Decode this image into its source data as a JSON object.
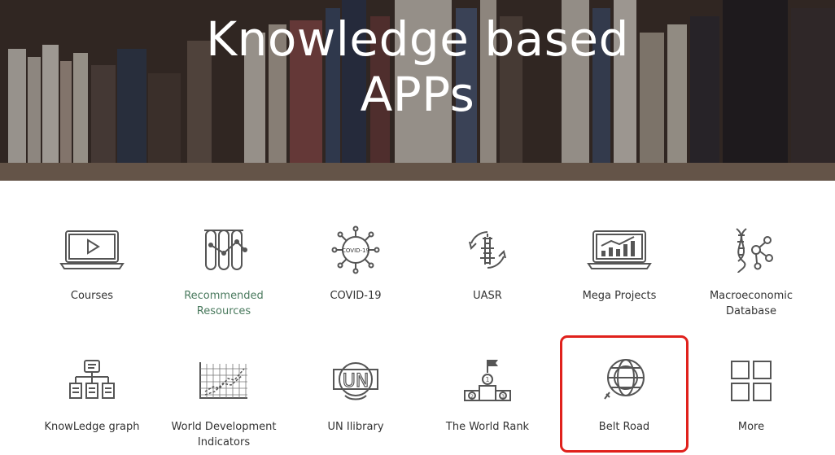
{
  "hero": {
    "title_line1": "Knowledge based",
    "title_line2": "APPs"
  },
  "apps": [
    {
      "label": "Courses",
      "icon": "laptop-video-icon"
    },
    {
      "label": "Recommended Resources",
      "icon": "test-tubes-icon"
    },
    {
      "label": "COVID-19",
      "icon": "virus-icon",
      "icon_text": "COVID-19"
    },
    {
      "label": "UASR",
      "icon": "pagoda-cycle-icon"
    },
    {
      "label": "Mega Projects",
      "icon": "laptop-chart-icon"
    },
    {
      "label": "Macroeconomic Database",
      "icon": "dna-molecule-icon"
    },
    {
      "label": "KnowLedge graph",
      "icon": "tree-chart-icon"
    },
    {
      "label": "World Development Indicators",
      "icon": "grid-trend-icon"
    },
    {
      "label": "UN Ilibrary",
      "icon": "un-emblem-icon",
      "icon_text": "UN"
    },
    {
      "label": "The World Rank",
      "icon": "podium-icon",
      "icon_text": [
        "1",
        "2",
        "3"
      ]
    },
    {
      "label": "Belt Road",
      "icon": "globe-icon"
    },
    {
      "label": "More",
      "icon": "four-squares-icon"
    }
  ],
  "colors": {
    "accent_label": "#4a7a5e",
    "highlight_border": "#e0211c",
    "icon_stroke": "#555555"
  }
}
